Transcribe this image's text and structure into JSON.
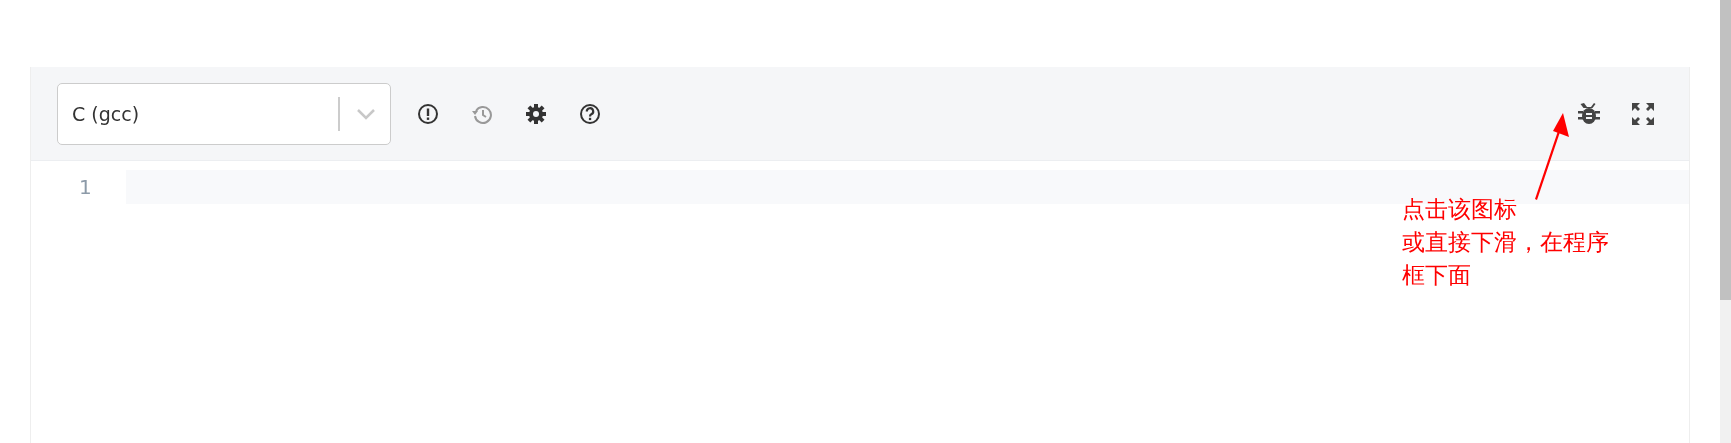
{
  "editor_toolbar": {
    "language_select": {
      "value": "C (gcc)"
    }
  },
  "editor": {
    "line_numbers": [
      "1"
    ]
  },
  "annotation": {
    "lines": [
      "点击该图标",
      "或直接下滑，在程序",
      "框下面"
    ]
  }
}
